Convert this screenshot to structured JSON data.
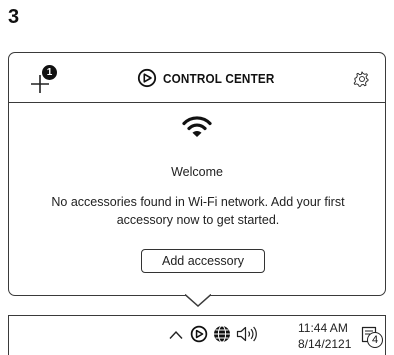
{
  "step": {
    "number": "3"
  },
  "header": {
    "add_badge_count": "1",
    "title": "CONTROL CENTER",
    "icons": {
      "add": "plus-icon",
      "brand": "elgato-logo-icon",
      "settings": "gear-icon"
    }
  },
  "content": {
    "status_icon": "wifi-icon",
    "welcome": "Welcome",
    "message": "No accessories found in Wi-Fi network. Add your first accessory now to get started.",
    "add_button_label": "Add accessory"
  },
  "taskbar": {
    "icons": [
      "chevron-up-icon",
      "control-center-tray-icon",
      "globe-icon",
      "speaker-icon"
    ],
    "time": "11:44 AM",
    "date": "8/14/2121",
    "notification_count": "4"
  },
  "colors": {
    "stroke": "#3a3a3a",
    "text": "#222222",
    "badge": "#111111"
  }
}
